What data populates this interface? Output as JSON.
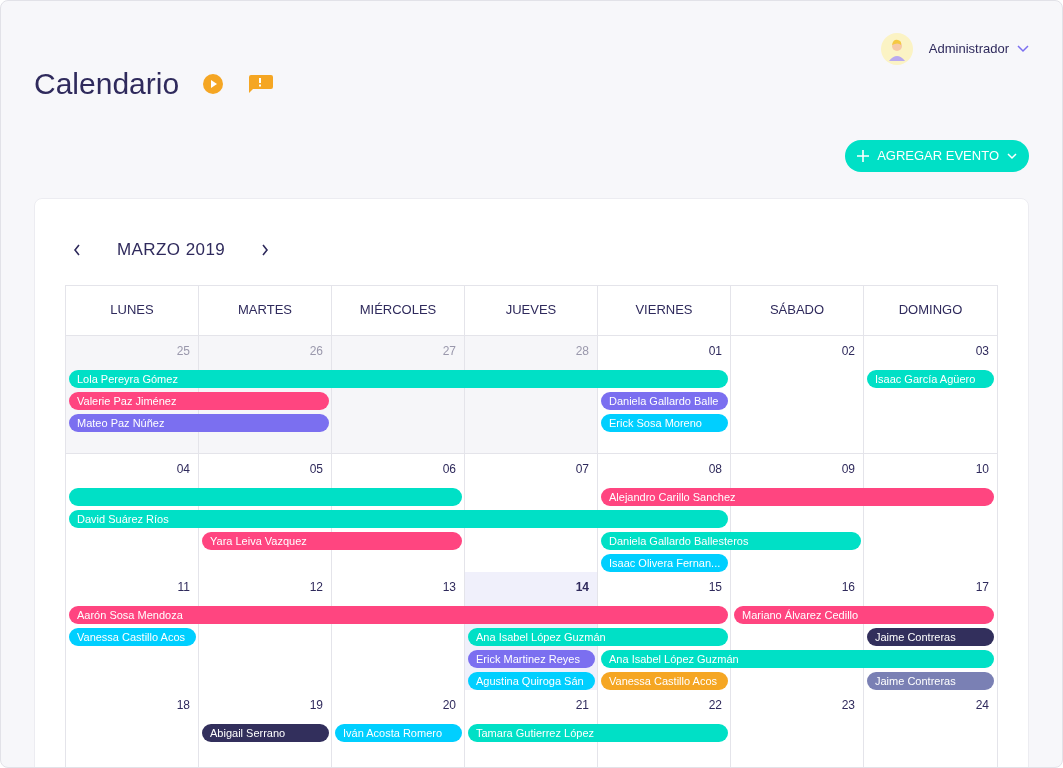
{
  "user": {
    "name": "Administrador"
  },
  "page": {
    "title": "Calendario"
  },
  "add_button": {
    "label": "AGREGAR EVENTO"
  },
  "calendar": {
    "month": "MARZO 2019",
    "weekdays": [
      "LUNES",
      "MARTES",
      "MIÉRCOLES",
      "JUEVES",
      "VIERNES",
      "SÁBADO",
      "DOMINGO"
    ],
    "weeks": [
      {
        "days": [
          {
            "number": "25",
            "muted": true,
            "today": false
          },
          {
            "number": "26",
            "muted": true,
            "today": false
          },
          {
            "number": "27",
            "muted": true,
            "today": false
          },
          {
            "number": "28",
            "muted": true,
            "today": false
          },
          {
            "number": "01",
            "muted": false,
            "today": false
          },
          {
            "number": "02",
            "muted": false,
            "today": false
          },
          {
            "number": "03",
            "muted": false,
            "today": false
          }
        ],
        "lanes": [
          [
            {
              "kind": "event",
              "name": "Lola Pereyra Gómez",
              "color": "#00e0c6"
            },
            {
              "kind": "continued"
            },
            {
              "kind": "continued"
            },
            {
              "kind": "continued"
            },
            {
              "kind": "continued"
            },
            {
              "kind": "empty"
            },
            {
              "kind": "event",
              "name": "Isaac García Agüero",
              "color": "#00e0c6"
            }
          ],
          [
            {
              "kind": "event",
              "name": "Valerie Paz Jiménez",
              "color": "#ff4580"
            },
            {
              "kind": "continued"
            },
            {
              "kind": "empty"
            },
            {
              "kind": "empty"
            },
            {
              "kind": "event",
              "name": "Daniela Gallardo Balle",
              "color": "#7b6ff0"
            },
            {
              "kind": "empty"
            },
            {
              "kind": "empty"
            }
          ],
          [
            {
              "kind": "event",
              "name": "Mateo Paz Núñez",
              "color": "#7b6ff0"
            },
            {
              "kind": "continued"
            },
            {
              "kind": "empty"
            },
            {
              "kind": "empty"
            },
            {
              "kind": "event",
              "name": "Erick Sosa Moreno",
              "color": "#00cfff"
            },
            {
              "kind": "empty"
            },
            {
              "kind": "empty"
            }
          ]
        ]
      },
      {
        "days": [
          {
            "number": "04",
            "muted": false,
            "today": false
          },
          {
            "number": "05",
            "muted": false,
            "today": false
          },
          {
            "number": "06",
            "muted": false,
            "today": false
          },
          {
            "number": "07",
            "muted": false,
            "today": false
          },
          {
            "number": "08",
            "muted": false,
            "today": false
          },
          {
            "number": "09",
            "muted": false,
            "today": false
          },
          {
            "number": "10",
            "muted": false,
            "today": false
          }
        ],
        "lanes": [
          [
            {
              "kind": "event",
              "color": "#00e0c6"
            },
            {
              "kind": "continued"
            },
            {
              "kind": "continued"
            },
            {
              "kind": "empty"
            },
            {
              "kind": "event",
              "name": "Alejandro Carillo Sanchez",
              "color": "#ff4580"
            },
            {
              "kind": "continued"
            },
            {
              "kind": "continued"
            }
          ],
          [
            {
              "kind": "event",
              "name": "David Suárez Ríos",
              "color": "#00e0c6"
            },
            {
              "kind": "continued"
            },
            {
              "kind": "continued"
            },
            {
              "kind": "continued"
            },
            {
              "kind": "continued"
            },
            {
              "kind": "empty"
            },
            {
              "kind": "empty"
            }
          ],
          [
            {
              "kind": "empty"
            },
            {
              "kind": "event",
              "name": "Yara Leiva Vazquez",
              "color": "#ff4580"
            },
            {
              "kind": "continued"
            },
            {
              "kind": "empty"
            },
            {
              "kind": "event",
              "name": "Daniela Gallardo Ballesteros",
              "color": "#00e0c6"
            },
            {
              "kind": "continued"
            },
            {
              "kind": "empty"
            }
          ],
          [
            {
              "kind": "empty"
            },
            {
              "kind": "empty"
            },
            {
              "kind": "empty"
            },
            {
              "kind": "empty"
            },
            {
              "kind": "event",
              "name": "Isaac Olivera Fernan...",
              "color": "#00cfff"
            },
            {
              "kind": "empty"
            },
            {
              "kind": "empty"
            }
          ]
        ]
      },
      {
        "days": [
          {
            "number": "11",
            "muted": false,
            "today": false
          },
          {
            "number": "12",
            "muted": false,
            "today": false
          },
          {
            "number": "13",
            "muted": false,
            "today": false
          },
          {
            "number": "14",
            "muted": false,
            "today": true
          },
          {
            "number": "15",
            "muted": false,
            "today": false
          },
          {
            "number": "16",
            "muted": false,
            "today": false
          },
          {
            "number": "17",
            "muted": false,
            "today": false
          }
        ],
        "lanes": [
          [
            {
              "kind": "event",
              "name": "Aarón Sosa Mendoza",
              "color": "#ff4580"
            },
            {
              "kind": "continued"
            },
            {
              "kind": "continued"
            },
            {
              "kind": "continued"
            },
            {
              "kind": "continued"
            },
            {
              "kind": "event",
              "name": "Mariano Álvarez Cedillo",
              "color": "#ff4580"
            },
            {
              "kind": "continued"
            }
          ],
          [
            {
              "kind": "event",
              "name": "Vanessa Castillo Acos",
              "color": "#00cfff"
            },
            {
              "kind": "empty"
            },
            {
              "kind": "empty"
            },
            {
              "kind": "event",
              "name": "Ana Isabel López Guzmán",
              "color": "#00e0c6"
            },
            {
              "kind": "continued"
            },
            {
              "kind": "empty"
            },
            {
              "kind": "event",
              "name": "Jaime Contreras",
              "color": "#322f5c"
            }
          ],
          [
            {
              "kind": "empty"
            },
            {
              "kind": "empty"
            },
            {
              "kind": "empty"
            },
            {
              "kind": "event",
              "name": "Erick Martinez Reyes",
              "color": "#7b6ff0"
            },
            {
              "kind": "event",
              "name": "Ana Isabel López Guzmán",
              "color": "#00e0c6"
            },
            {
              "kind": "continued"
            },
            {
              "kind": "continued"
            }
          ],
          [
            {
              "kind": "empty"
            },
            {
              "kind": "empty"
            },
            {
              "kind": "empty"
            },
            {
              "kind": "event",
              "name": "Agustina Quiroga Sán",
              "color": "#00cfff"
            },
            {
              "kind": "event",
              "name": "Vanessa Castillo Acos",
              "color": "#f5a623"
            },
            {
              "kind": "empty"
            },
            {
              "kind": "event",
              "name": "Jaime Contreras",
              "color": "#7a80b4"
            }
          ]
        ]
      },
      {
        "days": [
          {
            "number": "18",
            "muted": false,
            "today": false
          },
          {
            "number": "19",
            "muted": false,
            "today": false
          },
          {
            "number": "20",
            "muted": false,
            "today": false
          },
          {
            "number": "21",
            "muted": false,
            "today": false
          },
          {
            "number": "22",
            "muted": false,
            "today": false
          },
          {
            "number": "23",
            "muted": false,
            "today": false
          },
          {
            "number": "24",
            "muted": false,
            "today": false
          }
        ],
        "lanes": [
          [
            {
              "kind": "empty"
            },
            {
              "kind": "event",
              "name": "Abigail Serrano",
              "color": "#322f5c"
            },
            {
              "kind": "event",
              "name": "Iván Acosta Romero",
              "color": "#00cfff"
            },
            {
              "kind": "event",
              "name": "Tamara Gutierrez López",
              "color": "#00e0c6"
            },
            {
              "kind": "continued"
            },
            {
              "kind": "empty"
            },
            {
              "kind": "empty"
            }
          ]
        ]
      }
    ]
  }
}
